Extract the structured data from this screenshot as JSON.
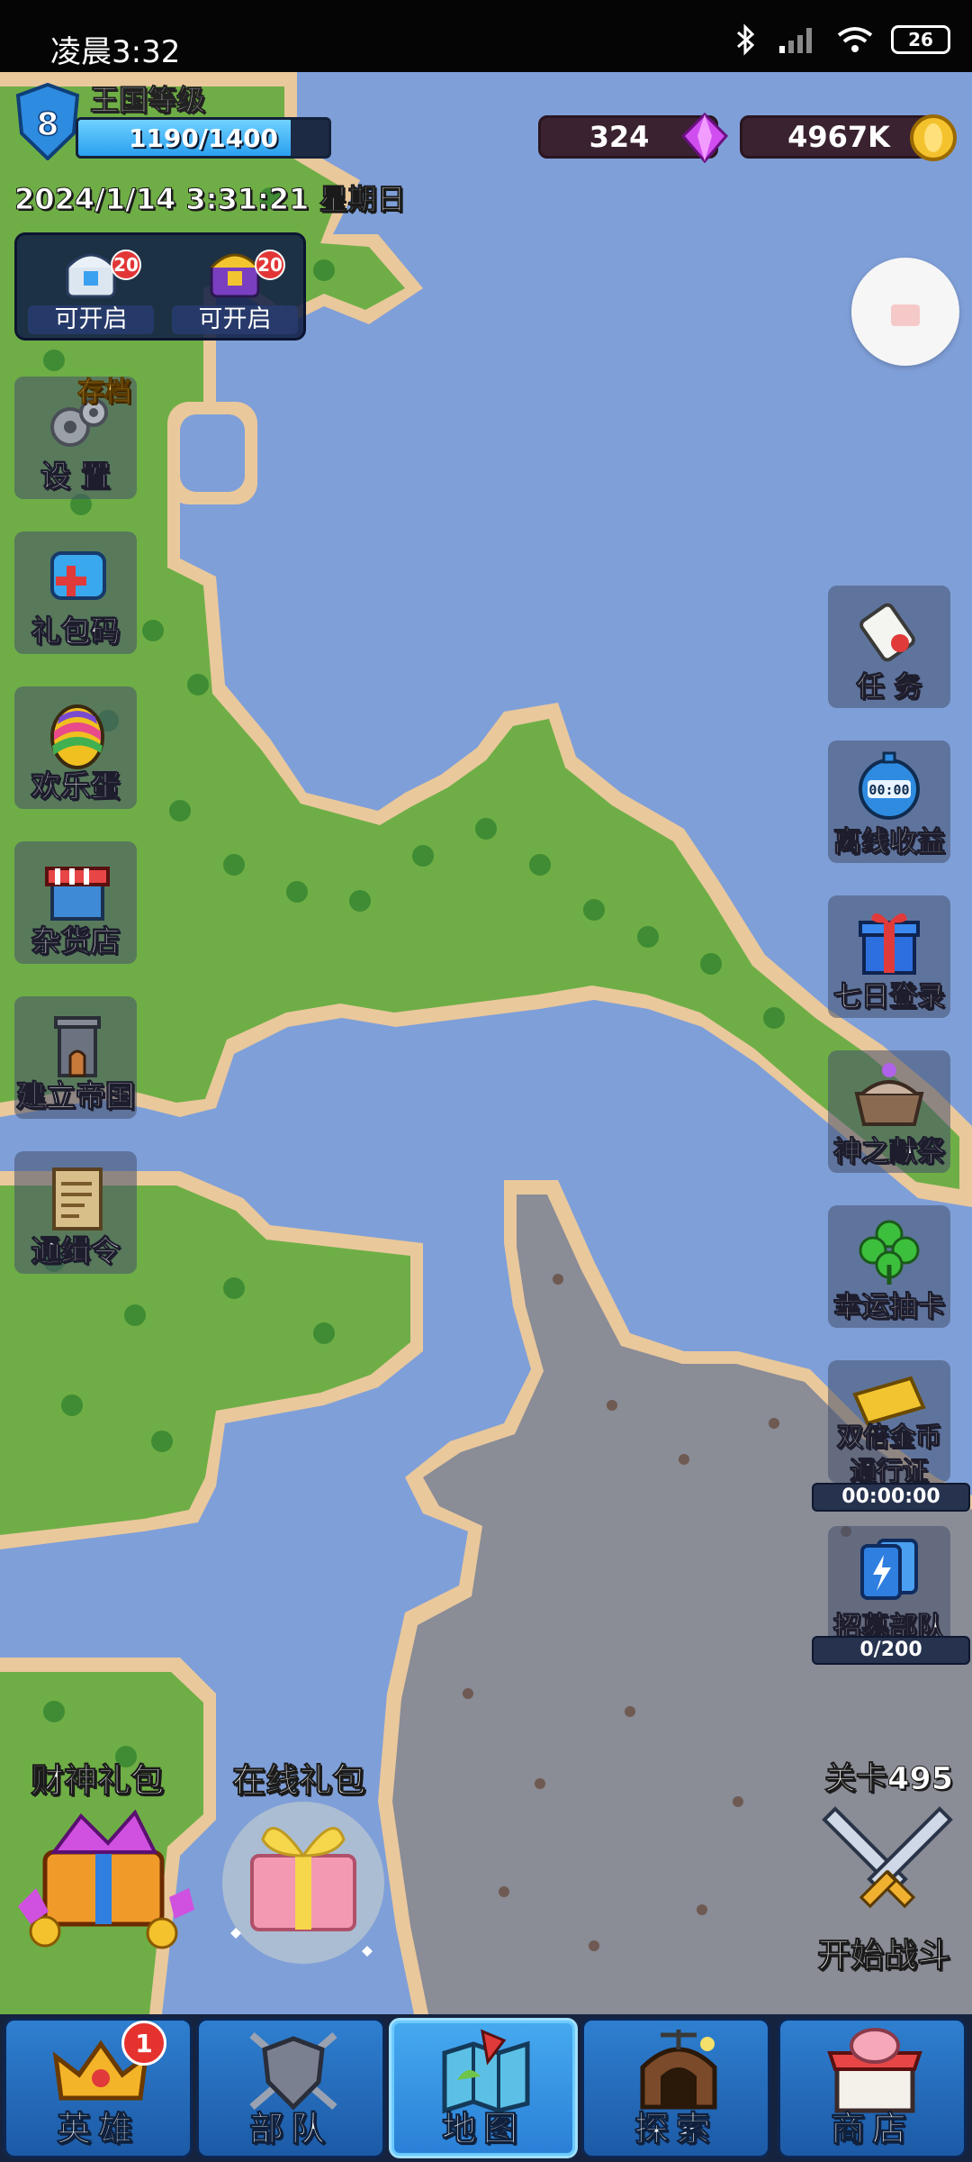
{
  "status_bar": {
    "time": "凌晨3:32",
    "battery": "26",
    "icons": [
      "bluetooth-icon",
      "hd-signal-icon",
      "wifi-icon",
      "battery-icon"
    ]
  },
  "kingdom": {
    "level": "8",
    "level_label": "王国等级",
    "xp_text": "1190/1400",
    "xp_progress": 0.85
  },
  "currency": {
    "gems": "324",
    "gold": "4967K"
  },
  "datetime": "2024/1/14 3:31:21 星期日",
  "chests": [
    {
      "label": "可开启",
      "badge": "20",
      "icon": "blue-chest-icon"
    },
    {
      "label": "可开启",
      "badge": "20",
      "icon": "gold-chest-icon"
    }
  ],
  "left_menu": [
    {
      "label": "设 置",
      "tag": "存档",
      "icon": "gear-icon"
    },
    {
      "label": "礼包码",
      "icon": "gift-code-icon"
    },
    {
      "label": "欢乐蛋",
      "icon": "rainbow-egg-icon"
    },
    {
      "label": "杂货店",
      "icon": "shop-stall-icon"
    },
    {
      "label": "建立帝国",
      "icon": "tower-icon"
    },
    {
      "label": "通缉令",
      "icon": "wanted-scroll-icon"
    }
  ],
  "right_menu": [
    {
      "label": "任 务",
      "icon": "quest-scroll-icon"
    },
    {
      "label": "离线收益",
      "icon": "stopwatch-icon",
      "display": "00:00"
    },
    {
      "label": "七日登录",
      "icon": "gift-box-icon"
    },
    {
      "label": "神之献祭",
      "icon": "altar-icon"
    },
    {
      "label": "幸运抽卡",
      "icon": "clover-icon"
    },
    {
      "label": "双倍金币\n通行证",
      "icon": "gold-ticket-icon",
      "timer": "00:00:00"
    },
    {
      "label": "招募部队",
      "icon": "recruit-cards-icon",
      "progress_text": "0/200"
    }
  ],
  "packs": {
    "fortune": "财神礼包",
    "online": "在线礼包"
  },
  "stage": {
    "label": "关卡495",
    "start": "开始战斗"
  },
  "nav": [
    {
      "label": "英雄",
      "icon": "crown-icon",
      "badge": "1",
      "active": false
    },
    {
      "label": "部队",
      "icon": "shield-swords-icon",
      "active": false
    },
    {
      "label": "地图",
      "icon": "map-icon",
      "active": true
    },
    {
      "label": "探索",
      "icon": "mine-icon",
      "active": false
    },
    {
      "label": "商店",
      "icon": "piggy-shop-icon",
      "active": false
    }
  ],
  "colors": {
    "water": "#7f9fd8",
    "grass": "#6fae46",
    "sand": "#e7c69a",
    "rock": "#8a8c96",
    "nav_blue": "#2a7fd6",
    "badge_red": "#e5322f"
  }
}
